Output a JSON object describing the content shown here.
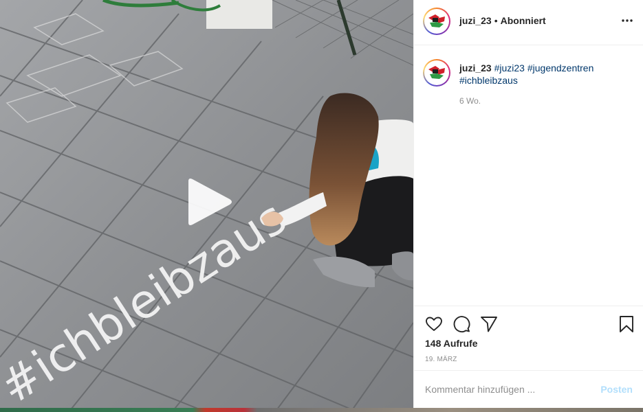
{
  "post": {
    "username": "juzi_23",
    "separator": "•",
    "follow_state": "Abonniert",
    "caption_username": "juzi_23",
    "hashtags": [
      "#juzi23",
      "#jugendzentren",
      "#ichbleibzaus"
    ],
    "time_ago": "6 Wo.",
    "views": "148 Aufrufe",
    "date": "19. MÄRZ",
    "chalk_text": "#ichbleibzaus"
  },
  "comment": {
    "placeholder": "Kommentar hinzufügen ...",
    "post_label": "Posten"
  },
  "icons": {
    "like": "heart-icon",
    "comment": "comment-bubble-icon",
    "share": "paper-plane-icon",
    "save": "bookmark-icon",
    "more": "more-options-icon",
    "play": "play-icon"
  },
  "colors": {
    "hashtag": "#00376b",
    "post_button_disabled": "#b2dffc",
    "muted_text": "#8e8e8e",
    "text": "#262626"
  }
}
